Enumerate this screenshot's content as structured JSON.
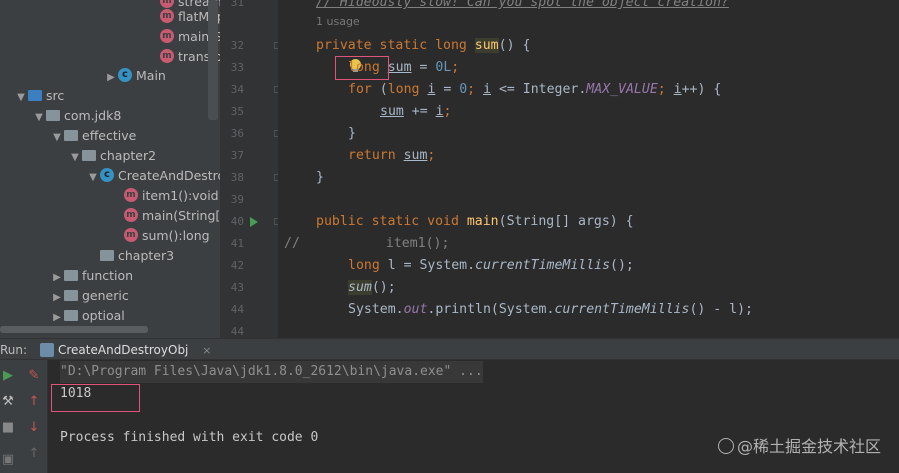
{
  "project_tree": {
    "top_items": [
      {
        "label": "stream",
        "icon": "method-icon"
      },
      {
        "label": "flatMap",
        "icon": "method-icon"
      },
      {
        "label": "main(St",
        "icon": "method-icon"
      },
      {
        "label": "transfo",
        "icon": "method-icon"
      }
    ],
    "main_class": "Main",
    "src": "src",
    "package": "com.jdk8",
    "effective": "effective",
    "chapter2": "chapter2",
    "class": "CreateAndDestro",
    "methods": [
      "item1():void",
      "main(String[])",
      "sum():long"
    ],
    "chapter3": "chapter3",
    "function": "function",
    "generic": "generic",
    "optional": "optioal"
  },
  "editor": {
    "usage_hint": "1 usage",
    "line_numbers": [
      "31",
      "32",
      "33",
      "34",
      "35",
      "36",
      "37",
      "38",
      "39",
      "40",
      "41",
      "42",
      "43",
      "44"
    ],
    "comment_line": "// Hideously slow! Can you spot the object creation?",
    "code": {
      "l32": {
        "kw": "private static long ",
        "fn": "sum",
        "rest": "() {"
      },
      "l33": {
        "type": "long",
        "var": "sum",
        "rest": " = ",
        "num": "0L",
        "end": ";"
      },
      "l34": {
        "kw1": "for",
        "p1": " (",
        "kw2": "long",
        "p2": " ",
        "v1": "i",
        "p3": " = ",
        "n1": "0",
        "p4": "; ",
        "v2": "i",
        "p5": " <= Integer.",
        "c": "MAX_VALUE",
        "p6": "; ",
        "v3": "i",
        "p7": "++) {"
      },
      "l35": {
        "v1": "sum",
        "op": " += ",
        "v2": "i",
        "end": ";"
      },
      "l36": "}",
      "l37": {
        "kw": "return ",
        "v": "sum",
        "end": ";"
      },
      "l38": "}",
      "l40": {
        "kw": "public static void ",
        "fn": "main",
        "rest": "(String[] args) {"
      },
      "l41": {
        "prefix": "//",
        "body": "item1();"
      },
      "l42": {
        "kw": "long ",
        "p1": "l = System.",
        "m": "currentTimeMillis",
        "p2": "();"
      },
      "l43": {
        "fn": "sum",
        "rest": "();"
      },
      "l44": {
        "p1": "System.",
        "s": "out",
        "p2": ".println(System.",
        "m": "currentTimeMillis",
        "p3": "() - l);"
      }
    }
  },
  "run_panel": {
    "label": "Run:",
    "tab": "CreateAndDestroyObj",
    "close": "×",
    "command": "\"D:\\Program Files\\Java\\jdk1.8.0_2612\\bin\\java.exe\" ...",
    "output": "1018",
    "exit": "Process finished with exit code 0"
  },
  "watermark": "@稀土掘金技术社区",
  "colors": {
    "keyword": "#cc7832",
    "function": "#ffc66d",
    "number": "#6897bb",
    "highlight_box": "#e0547c"
  }
}
